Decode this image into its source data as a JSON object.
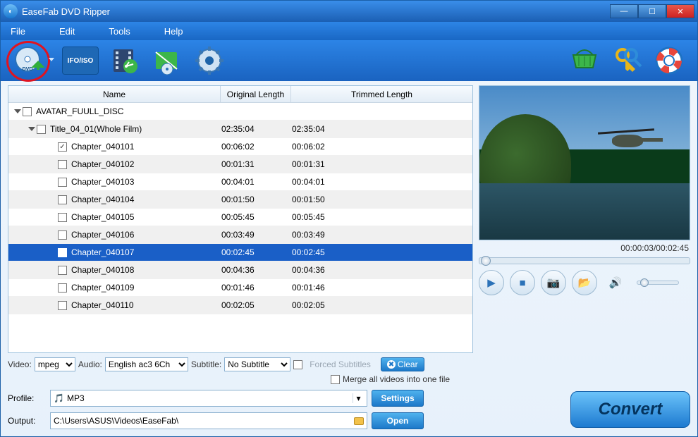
{
  "title": "EaseFab DVD Ripper",
  "menu": {
    "file": "File",
    "edit": "Edit",
    "tools": "Tools",
    "help": "Help"
  },
  "toolbar": {
    "load_dvd": "Load DVD",
    "ifoiso": "IFO/ISO",
    "edit_video": "Edit Video",
    "crop": "Crop",
    "settings": "Settings",
    "basket": "Purchase",
    "key": "Register",
    "help": "Help"
  },
  "columns": {
    "name": "Name",
    "orig": "Original Length",
    "trim": "Trimmed Length"
  },
  "disc": {
    "name": "AVATAR_FUULL_DISC"
  },
  "title_row": {
    "name": "Title_04_01(Whole Film)",
    "orig": "02:35:04",
    "trim": "02:35:04"
  },
  "chapters": [
    {
      "name": "Chapter_040101",
      "orig": "00:06:02",
      "trim": "00:06:02",
      "checked": true
    },
    {
      "name": "Chapter_040102",
      "orig": "00:01:31",
      "trim": "00:01:31",
      "checked": false
    },
    {
      "name": "Chapter_040103",
      "orig": "00:04:01",
      "trim": "00:04:01",
      "checked": false
    },
    {
      "name": "Chapter_040104",
      "orig": "00:01:50",
      "trim": "00:01:50",
      "checked": false
    },
    {
      "name": "Chapter_040105",
      "orig": "00:05:45",
      "trim": "00:05:45",
      "checked": false
    },
    {
      "name": "Chapter_040106",
      "orig": "00:03:49",
      "trim": "00:03:49",
      "checked": false
    },
    {
      "name": "Chapter_040107",
      "orig": "00:02:45",
      "trim": "00:02:45",
      "checked": false,
      "selected": true
    },
    {
      "name": "Chapter_040108",
      "orig": "00:04:36",
      "trim": "00:04:36",
      "checked": false
    },
    {
      "name": "Chapter_040109",
      "orig": "00:01:46",
      "trim": "00:01:46",
      "checked": false
    },
    {
      "name": "Chapter_040110",
      "orig": "00:02:05",
      "trim": "00:02:05",
      "checked": false
    }
  ],
  "opts": {
    "video_lbl": "Video:",
    "video_val": "mpeg",
    "audio_lbl": "Audio:",
    "audio_val": "English ac3 6Ch",
    "subtitle_lbl": "Subtitle:",
    "subtitle_val": "No Subtitle",
    "forced": "Forced Subtitles",
    "clear": "Clear",
    "merge": "Merge all videos into one file"
  },
  "preview": {
    "time": "00:00:03/00:02:45"
  },
  "bottom": {
    "profile_lbl": "Profile:",
    "profile_val": "MP3",
    "settings": "Settings",
    "output_lbl": "Output:",
    "output_val": "C:\\Users\\ASUS\\Videos\\EaseFab\\",
    "open": "Open",
    "convert": "Convert"
  }
}
